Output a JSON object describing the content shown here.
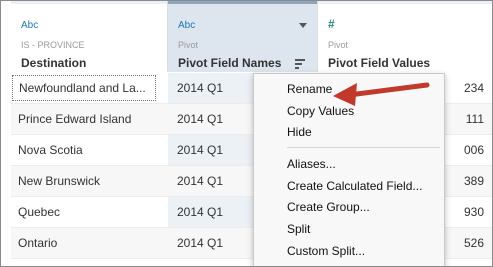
{
  "columns": [
    {
      "type_icon": "Abc",
      "origin": "IS - PROVINCE",
      "name": "Destination"
    },
    {
      "type_icon": "Abc",
      "origin": "Pivot",
      "name": "Pivot Field Names"
    },
    {
      "type_icon": "#",
      "origin": "Pivot",
      "name": "Pivot Field Values"
    }
  ],
  "rows": [
    {
      "destination": "Newfoundland and La...",
      "pivot": "2014 Q1",
      "value": "234"
    },
    {
      "destination": "Prince Edward Island",
      "pivot": "2014 Q1",
      "value": "111"
    },
    {
      "destination": "Nova Scotia",
      "pivot": "2014 Q1",
      "value": "006"
    },
    {
      "destination": "New Brunswick",
      "pivot": "2014 Q1",
      "value": "389"
    },
    {
      "destination": "Quebec",
      "pivot": "2014 Q1",
      "value": "930"
    },
    {
      "destination": "Ontario",
      "pivot": "2014 Q1",
      "value": "526"
    }
  ],
  "menu": {
    "items": [
      "Rename",
      "Copy Values",
      "Hide",
      "Aliases...",
      "Create Calculated Field...",
      "Create Group...",
      "Split",
      "Custom Split..."
    ]
  },
  "colors": {
    "annotation_arrow": "#c0392b",
    "selected_header": "#dde6ee"
  }
}
